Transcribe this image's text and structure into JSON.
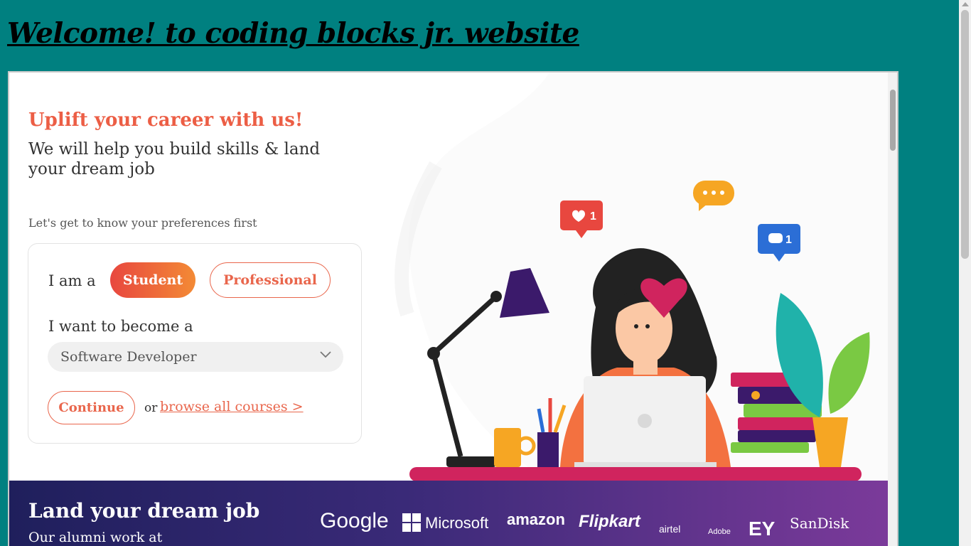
{
  "page": {
    "title": "Welcome! to coding blocks jr. website"
  },
  "hero": {
    "headline": "Uplift your career with us!",
    "subheadline": "We will help you build skills & land your dream job",
    "preferences_prompt": "Let's get to know your preferences first"
  },
  "form": {
    "i_am_label": "I am a",
    "role_options": [
      "Student",
      "Professional"
    ],
    "selected_role": "Student",
    "goal_label": "I want to become a",
    "goal_value": "Software Developer",
    "continue_label": "Continue",
    "or_text": "or",
    "browse_label": "browse all courses >"
  },
  "illustration": {
    "like_count": "1",
    "comment_count": "1"
  },
  "band": {
    "title": "Land your dream job",
    "subtitle": "Our alumni work at",
    "companies": [
      "Google",
      "Microsoft",
      "amazon",
      "Flipkart",
      "airtel",
      "Adobe",
      "EY",
      "SanDisk"
    ]
  },
  "colors": {
    "page_background": "#008080",
    "accent": "#ec5e45",
    "accent_gradient_start": "#e8473f",
    "accent_gradient_end": "#f38a35",
    "band_start": "#1f1f5c",
    "band_end": "#7b3a9a"
  }
}
